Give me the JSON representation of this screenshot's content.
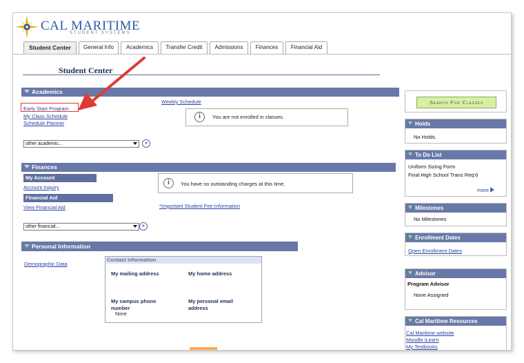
{
  "brand": {
    "name": "CAL MARITIME",
    "tagline": "STUDENT SYSTEMS"
  },
  "tabs": [
    {
      "label": "Student Center"
    },
    {
      "label": "General Info"
    },
    {
      "label": "Academics"
    },
    {
      "label": "Transfer Credit"
    },
    {
      "label": "Admissions"
    },
    {
      "label": "Finances"
    },
    {
      "label": "Financial Aid"
    }
  ],
  "page_title": "Student Center",
  "academics": {
    "header": "Academics",
    "links": [
      "Early Start Program",
      "My Class Schedule",
      "Schedule Planner"
    ],
    "weekly_schedule": "Weekly Schedule",
    "message": "You are not enrolled in classes.",
    "dropdown": "other academic..."
  },
  "finances": {
    "header": "Finances",
    "my_account_header": "My Account",
    "account_inquiry": "Account Inquiry",
    "financial_aid_header": "Financial Aid",
    "view_financial_aid": "View Financial Aid",
    "message": "You have no outstanding charges at this time.",
    "fee_link": "*Important Student Fee Information",
    "dropdown": "other financial..."
  },
  "personal": {
    "header": "Personal Information",
    "demographic_link": "Demographic Data",
    "contact_header": "Contact Information",
    "mailing": "My mailing address",
    "home": "My home address",
    "campus_phone": "My campus phone number",
    "campus_phone_value": "None",
    "personal_email": "My personal email address"
  },
  "sidebar": {
    "search_button": "Search For Classes",
    "holds": {
      "header": "Holds",
      "text": "No Holds."
    },
    "todo": {
      "header": "To Do List",
      "items": [
        "Uniform Sizing Form",
        "Final High School Trans Req'd"
      ],
      "more": "more"
    },
    "milestones": {
      "header": "Milestones",
      "text": "No Milestones"
    },
    "enrollment": {
      "header": "Enrollment Dates",
      "link": "Open Enrollment Dates"
    },
    "advisor": {
      "header": "Advisor",
      "title": "Program Advisor",
      "value": "None Assigned"
    },
    "resources": {
      "header": "Cal Maritime Resources",
      "links": [
        "Cal Maritime website",
        "Moodle iLearn",
        "My Textbooks"
      ]
    }
  },
  "colors": {
    "section_bar": "#6878a8",
    "link": "#2a3fa6",
    "brand": "#2b5aa6",
    "search_button": "#d9f0a3",
    "highlight": "#e23a30"
  }
}
